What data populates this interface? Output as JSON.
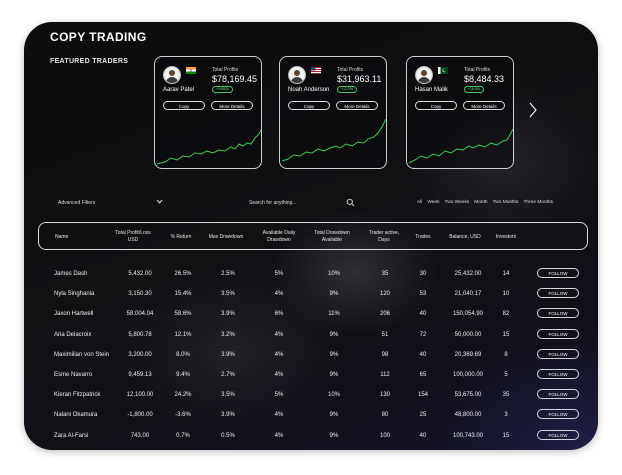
{
  "page": {
    "title": "COPY TRADING",
    "featured_label": "FEATURED TRADERS"
  },
  "featured": [
    {
      "name": "Aarav Patel",
      "flag": "india-flag",
      "total_label": "Total Profits",
      "total_value": "$78,169.45",
      "badge": "+1986%",
      "copy_label": "Copy",
      "more_label": "More Details"
    },
    {
      "name": "Noah Anderson",
      "flag": "usa-flag",
      "total_label": "Total Profits",
      "total_value": "$31,963.11",
      "badge": "+12.0%",
      "copy_label": "Copy",
      "more_label": "More Details"
    },
    {
      "name": "Hasan Malik",
      "flag": "pakistan-flag",
      "total_label": "Total Profits",
      "total_value": "$8,484.33",
      "badge": "+18.8%",
      "copy_label": "Copy",
      "more_label": "More Details"
    }
  ],
  "filters": {
    "advanced_label": "Advanced Filters",
    "search_placeholder": "Search for anything...",
    "periods": [
      "All",
      "Week",
      "Two Weeks",
      "Month",
      "Two Months",
      "Three Months"
    ]
  },
  "table": {
    "headers": {
      "name": "Name",
      "total_pl": "Total Profit/Loss USD",
      "return": "% Return",
      "max_dd": "Max Drawdown",
      "avail_daily": "Available Daily Drawdown",
      "total_dd": "Total Drawdown Available",
      "active": "Trader active, Days",
      "trades": "Trades",
      "balance": "Balance, USD",
      "investors": "Investors"
    },
    "follow_label": "FOLLOW",
    "rows": [
      {
        "name": "James Dash",
        "pl": "5,432.00",
        "ret": "26.5%",
        "mdd": "2.5%",
        "add": "5%",
        "tdd": "10%",
        "days": "35",
        "trades": "30",
        "bal": "25,432.00",
        "inv": "14"
      },
      {
        "name": "Nyla Singhania",
        "pl": "3,150.30",
        "ret": "15.4%",
        "mdd": "3.5%",
        "add": "4%",
        "tdd": "9%",
        "days": "120",
        "trades": "53",
        "bal": "21,040.17",
        "inv": "10"
      },
      {
        "name": "Jaxon Hartwell",
        "pl": "58,004.04",
        "ret": "58.6%",
        "mdd": "3.9%",
        "add": "6%",
        "tdd": "11%",
        "days": "206",
        "trades": "40",
        "bal": "150,054.90",
        "inv": "82"
      },
      {
        "name": "Aria Delacroix",
        "pl": "5,800.78",
        "ret": "12.1%",
        "mdd": "3.2%",
        "add": "4%",
        "tdd": "9%",
        "days": "51",
        "trades": "72",
        "bal": "50,000.00",
        "inv": "15"
      },
      {
        "name": "Maximilian von Stein",
        "pl": "3,200.00",
        "ret": "8.0%",
        "mdd": "3.9%",
        "add": "4%",
        "tdd": "9%",
        "days": "98",
        "trades": "40",
        "bal": "20,369.69",
        "inv": "8"
      },
      {
        "name": "Esme Navarro",
        "pl": "9,459.13",
        "ret": "9.4%",
        "mdd": "2.7%",
        "add": "4%",
        "tdd": "9%",
        "days": "112",
        "trades": "65",
        "bal": "100,000.00",
        "inv": "5"
      },
      {
        "name": "Kieran Fitzpatrick",
        "pl": "12,100.00",
        "ret": "24.2%",
        "mdd": "3.5%",
        "add": "5%",
        "tdd": "10%",
        "days": "130",
        "trades": "154",
        "bal": "53,675.00",
        "inv": "35"
      },
      {
        "name": "Nalani Okamura",
        "pl": "-1,800.00",
        "ret": "-3.6%",
        "mdd": "3.9%",
        "add": "4%",
        "tdd": "9%",
        "days": "80",
        "trades": "25",
        "bal": "48,800.00",
        "inv": "3"
      },
      {
        "name": "Zara Al-Farsi",
        "pl": "743.00",
        "ret": "0.7%",
        "mdd": "0.5%",
        "add": "4%",
        "tdd": "9%",
        "days": "100",
        "trades": "40",
        "bal": "100,743.00",
        "inv": "15"
      }
    ]
  }
}
